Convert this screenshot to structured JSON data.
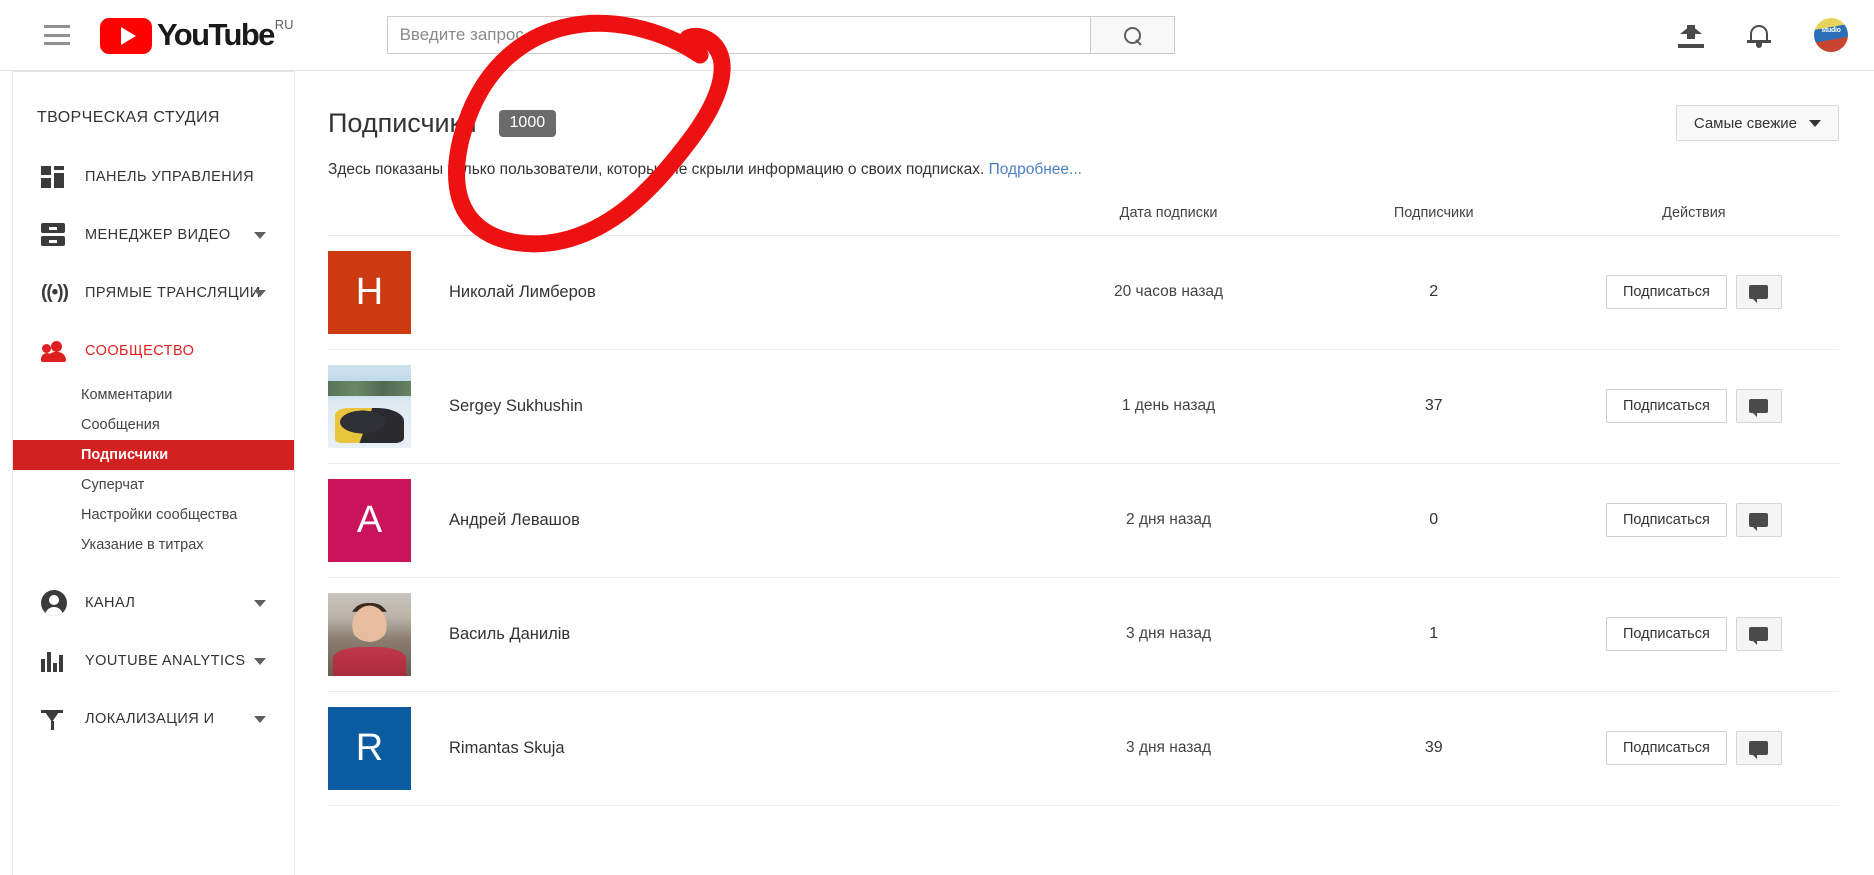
{
  "topbar": {
    "menu_icon": "hamburger-icon",
    "brand": "YouTube",
    "brand_country": "RU",
    "search_placeholder": "Введите запрос",
    "search_value": "",
    "search_icon": "search-icon",
    "upload_icon": "upload-icon",
    "notifications_icon": "bell-icon",
    "avatar_label": "studio"
  },
  "sidebar": {
    "title": "ТВОРЧЕСКАЯ СТУДИЯ",
    "items": [
      {
        "label": "ПАНЕЛЬ УПРАВЛЕНИЯ",
        "icon": "dashboard-icon",
        "expandable": false,
        "active": false
      },
      {
        "label": "МЕНЕДЖЕР ВИДЕО",
        "icon": "video-manager-icon",
        "expandable": true,
        "active": false
      },
      {
        "label": "ПРЯМЫЕ ТРАНСЛЯЦИИ",
        "icon": "live-broadcast-icon",
        "expandable": true,
        "active": false
      },
      {
        "label": "СООБЩЕСТВО",
        "icon": "community-icon",
        "expandable": false,
        "active": true
      },
      {
        "label": "КАНАЛ",
        "icon": "channel-icon",
        "expandable": true,
        "active": false
      },
      {
        "label": "YOUTUBE ANALYTICS",
        "icon": "analytics-icon",
        "expandable": true,
        "active": false
      },
      {
        "label": "ЛОКАЛИЗАЦИЯ И",
        "icon": "localization-icon",
        "expandable": true,
        "active": false
      }
    ],
    "community_subitems": [
      {
        "label": "Комментарии",
        "selected": false
      },
      {
        "label": "Сообщения",
        "selected": false
      },
      {
        "label": "Подписчики",
        "selected": true
      },
      {
        "label": "Суперчат",
        "selected": false
      },
      {
        "label": "Настройки сообщества",
        "selected": false
      },
      {
        "label": "Указание в титрах",
        "selected": false
      }
    ],
    "active_color": "#d32020"
  },
  "main": {
    "page_title": "Подписчики",
    "count_badge": "1000",
    "sort_label": "Самые свежие",
    "sort_icon": "chevron-down-icon",
    "description_before_link": "Здесь показаны только пользователи, которые не скрыли информацию о своих подписках. ",
    "description_link": "Подробнее...",
    "columns": {
      "user": "",
      "date": "Дата подписки",
      "subs": "Подписчики",
      "actions": "Действия"
    },
    "subscribe_label": "Подписаться",
    "message_icon": "message-bubble-icon",
    "rows": [
      {
        "name": "Николай Лимберов",
        "date": "20 часов назад",
        "subscribers": "2",
        "avatar_type": "letter",
        "avatar_letter": "Н",
        "avatar_color": "#cc3a12"
      },
      {
        "name": "Sergey Sukhushin",
        "date": "1 день назад",
        "subscribers": "37",
        "avatar_type": "photo-snowmobile",
        "avatar_letter": "",
        "avatar_color": "#b9d6e8"
      },
      {
        "name": "Андрей Левашов",
        "date": "2 дня назад",
        "subscribers": "0",
        "avatar_type": "letter",
        "avatar_letter": "А",
        "avatar_color": "#c9145c"
      },
      {
        "name": "Василь Данилів",
        "date": "3 дня назад",
        "subscribers": "1",
        "avatar_type": "photo-man",
        "avatar_letter": "",
        "avatar_color": "#8c7f72"
      },
      {
        "name": "Rimantas Skuja",
        "date": "3 дня назад",
        "subscribers": "39",
        "avatar_type": "letter",
        "avatar_letter": "R",
        "avatar_color": "#0a5ba0"
      }
    ]
  },
  "annotation": {
    "type": "hand-drawn-circle",
    "color": "#ee1111",
    "target": "count_badge"
  }
}
